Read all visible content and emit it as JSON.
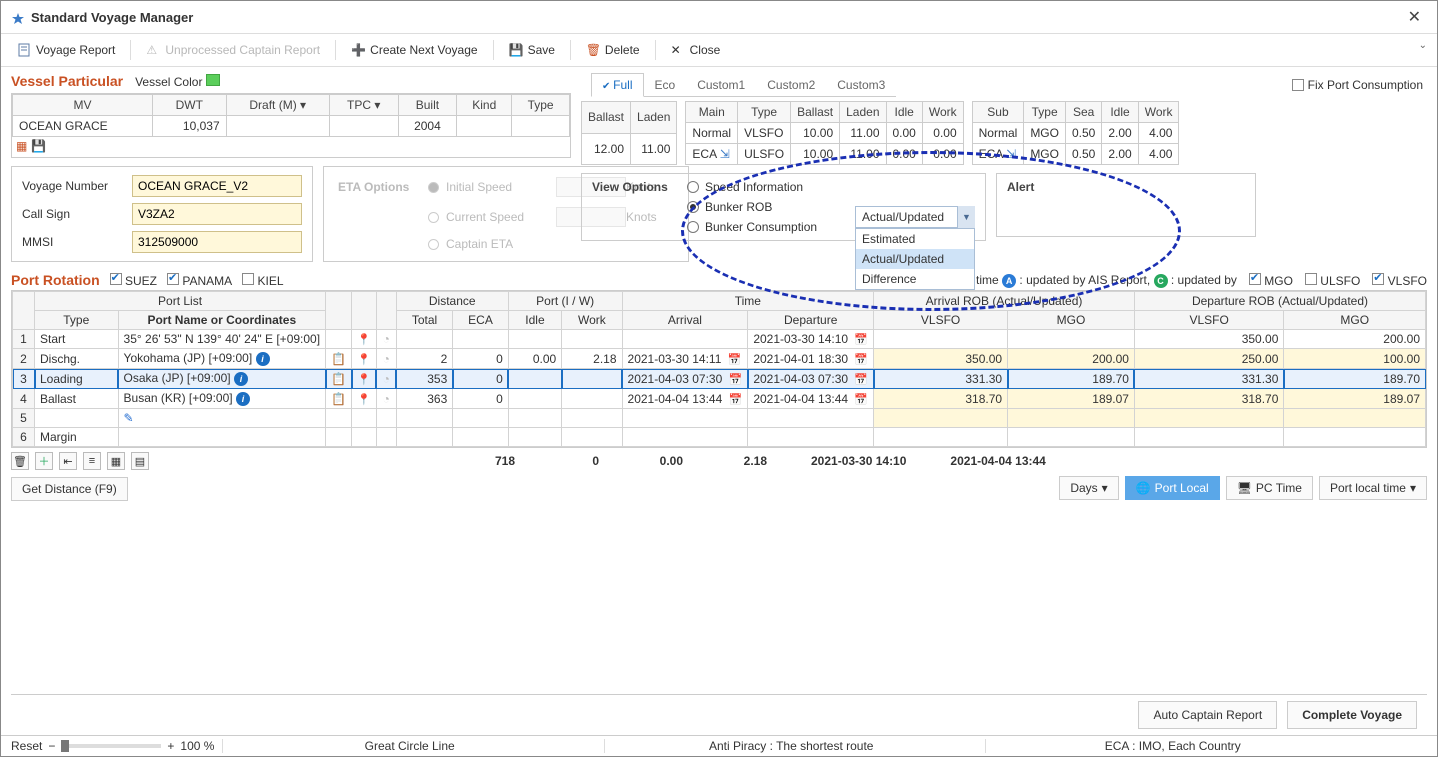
{
  "titlebar": {
    "title": "Standard Voyage Manager"
  },
  "toolbar": {
    "voyage_report": "Voyage Report",
    "unprocessed": "Unprocessed Captain Report",
    "create_next": "Create Next Voyage",
    "save": "Save",
    "delete": "Delete",
    "close": "Close"
  },
  "vessel_particular": {
    "title": "Vessel Particular",
    "color_label": "Vessel Color",
    "headers": {
      "mv": "MV",
      "dwt": "DWT",
      "draft": "Draft (M)",
      "tpc": "TPC",
      "built": "Built",
      "kind": "Kind",
      "type": "Type"
    },
    "row": {
      "mv": "OCEAN GRACE",
      "dwt": "10,037",
      "draft": "",
      "tpc": "",
      "built": "2004",
      "kind": "",
      "type": ""
    }
  },
  "id_fields": {
    "voyage_number_label": "Voyage Number",
    "voyage_number": "OCEAN GRACE_V2",
    "call_sign_label": "Call Sign",
    "call_sign": "V3ZA2",
    "mmsi_label": "MMSI",
    "mmsi": "312509000"
  },
  "eta": {
    "title": "ETA Options",
    "initial": "Initial Speed",
    "current": "Current Speed",
    "captain": "Captain ETA",
    "knots": "Knots"
  },
  "tabs": {
    "full": "Full",
    "eco": "Eco",
    "c1": "Custom1",
    "c2": "Custom2",
    "c3": "Custom3",
    "fixport": "Fix Port Consumption"
  },
  "bl_table": {
    "h_ballast": "Ballast",
    "h_laden": "Laden",
    "ballast": "12.00",
    "laden": "11.00"
  },
  "main_table": {
    "h": {
      "main": "Main",
      "type": "Type",
      "ballast": "Ballast",
      "laden": "Laden",
      "idle": "Idle",
      "work": "Work"
    },
    "rows": [
      {
        "main": "Normal",
        "type": "VLSFO",
        "ballast": "10.00",
        "laden": "11.00",
        "idle": "0.00",
        "work": "0.00"
      },
      {
        "main": "ECA",
        "type": "ULSFO",
        "ballast": "10.00",
        "laden": "11.00",
        "idle": "0.00",
        "work": "0.00"
      }
    ]
  },
  "sub_table": {
    "h": {
      "sub": "Sub",
      "type": "Type",
      "sea": "Sea",
      "idle": "Idle",
      "work": "Work"
    },
    "rows": [
      {
        "sub": "Normal",
        "type": "MGO",
        "sea": "0.50",
        "idle": "2.00",
        "work": "4.00"
      },
      {
        "sub": "ECA",
        "type": "MGO",
        "sea": "0.50",
        "idle": "2.00",
        "work": "4.00"
      }
    ]
  },
  "viewopt": {
    "label": "View Options",
    "speed": "Speed Information",
    "rob": "Bunker ROB",
    "cons": "Bunker Consumption",
    "ddown_value": "Actual/Updated",
    "ddown_opts": {
      "est": "Estimated",
      "act": "Actual/Updated",
      "dif": "Difference"
    }
  },
  "alert": {
    "label": "Alert"
  },
  "port_rotation": {
    "title": "Port Rotation",
    "canals": {
      "suez": "SUEZ",
      "panama": "PANAMA",
      "kiel": "KIEL"
    },
    "legend_text1": "Arrival / Departure time",
    "legend_a": ": updated by AIS Report,",
    "legend_c": ": updated by",
    "chk_mgo": "MGO",
    "chk_ulsfo": "ULSFO",
    "chk_vlsfo": "VLSFO"
  },
  "table_headers": {
    "port_list": "Port List",
    "distance": "Distance",
    "port_iw": "Port (I / W)",
    "time": "Time",
    "arr_rob": "Arrival ROB (Actual/Updated)",
    "dep_rob": "Departure ROB (Actual/Updated)",
    "type": "Type",
    "portname": "Port Name or Coordinates",
    "total": "Total",
    "eca": "ECA",
    "idle": "Idle",
    "work": "Work",
    "arrival": "Arrival",
    "departure": "Departure",
    "vlsfo": "VLSFO",
    "mgo": "MGO"
  },
  "rows": [
    {
      "n": "1",
      "type": "Start",
      "port": "35° 26' 53\" N 139° 40' 24\" E [+09:00]",
      "total": "",
      "eca": "",
      "idle": "",
      "work": "",
      "arr": "",
      "dep": "2021-03-30 14:10",
      "arr_vlsfo": "",
      "arr_mgo": "",
      "dep_vlsfo": "350.00",
      "dep_mgo": "200.00"
    },
    {
      "n": "2",
      "type": "Dischg.",
      "port": "Yokohama (JP) [+09:00]",
      "total": "2",
      "eca": "0",
      "idle": "0.00",
      "work": "2.18",
      "arr": "2021-03-30 14:11",
      "dep": "2021-04-01 18:30",
      "arr_vlsfo": "350.00",
      "arr_mgo": "200.00",
      "dep_vlsfo": "250.00",
      "dep_mgo": "100.00"
    },
    {
      "n": "3",
      "type": "Loading",
      "port": "Osaka (JP) [+09:00]",
      "total": "353",
      "eca": "0",
      "idle": "",
      "work": "",
      "arr": "2021-04-03 07:30",
      "dep": "2021-04-03 07:30",
      "arr_vlsfo": "331.30",
      "arr_mgo": "189.70",
      "dep_vlsfo": "331.30",
      "dep_mgo": "189.70"
    },
    {
      "n": "4",
      "type": "Ballast",
      "port": "Busan (KR) [+09:00]",
      "total": "363",
      "eca": "0",
      "idle": "",
      "work": "",
      "arr": "2021-04-04 13:44",
      "dep": "2021-04-04 13:44",
      "arr_vlsfo": "318.70",
      "arr_mgo": "189.07",
      "dep_vlsfo": "318.70",
      "dep_mgo": "189.07"
    },
    {
      "n": "5",
      "type": "",
      "port": "",
      "total": "",
      "eca": "",
      "idle": "",
      "work": "",
      "arr": "",
      "dep": "",
      "arr_vlsfo": "",
      "arr_mgo": "",
      "dep_vlsfo": "",
      "dep_mgo": ""
    },
    {
      "n": "6",
      "type": "Margin",
      "port": "",
      "total": "",
      "eca": "",
      "idle": "",
      "work": "",
      "arr": "",
      "dep": "",
      "arr_vlsfo": "",
      "arr_mgo": "",
      "dep_vlsfo": "",
      "dep_mgo": ""
    }
  ],
  "totals": {
    "total": "718",
    "eca": "0",
    "idle": "0.00",
    "work": "2.18",
    "arr": "2021-03-30 14:10",
    "dep": "2021-04-04 13:44"
  },
  "get_distance": "Get Distance (F9)",
  "botbtns": {
    "days": "Days",
    "portlocal": "Port Local",
    "pctime": "PC Time",
    "portlocaltime": "Port local time"
  },
  "footer": {
    "auto": "Auto Captain Report",
    "complete": "Complete Voyage"
  },
  "status": {
    "reset": "Reset",
    "zoom": "100 %",
    "gcl": "Great Circle Line",
    "anti": "Anti Piracy : The shortest route",
    "eca": "ECA : IMO, Each Country"
  }
}
